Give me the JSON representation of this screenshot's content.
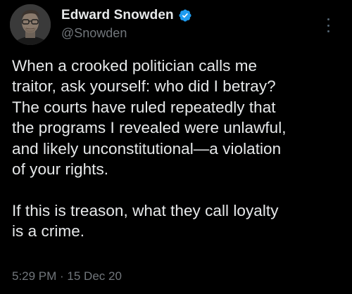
{
  "author": {
    "display_name": "Edward Snowden",
    "handle": "@Snowden",
    "verified_icon": "verified-badge-icon",
    "verified_color": "#1d9bf0"
  },
  "tweet": {
    "text": "When a crooked politician calls me\ntraitor, ask yourself: who did I betray?\nThe courts have ruled repeatedly that\nthe programs I revealed were unlawful,\nand likely unconstitutional—a violation\nof your rights.\n\nIf this is treason, what they call loyalty\nis a crime.",
    "timestamp": "5:29 PM · 15 Dec 20"
  },
  "menu": {
    "icon": "more-options-icon"
  },
  "colors": {
    "background": "#000000",
    "text": "#e7e9ea",
    "secondary": "#71767b"
  }
}
